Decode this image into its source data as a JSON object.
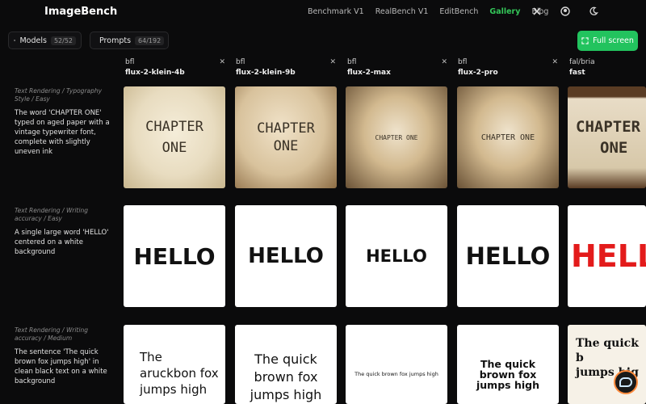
{
  "app": {
    "title": "ImageBench"
  },
  "nav": {
    "links": [
      "Benchmark V1",
      "RealBench V1",
      "EditBench",
      "Gallery",
      "Blog"
    ],
    "active": "Gallery"
  },
  "controls": {
    "models_label": "Models",
    "models_count": "52/52",
    "prompts_label": "Prompts",
    "prompts_count": "64/192",
    "fullscreen_label": "Full screen"
  },
  "columns": [
    {
      "provider": "bfl",
      "model": "flux-2-klein-4b"
    },
    {
      "provider": "bfl",
      "model": "flux-2-klein-9b"
    },
    {
      "provider": "bfl",
      "model": "flux-2-max"
    },
    {
      "provider": "bfl",
      "model": "flux-2-pro"
    },
    {
      "provider": "fal/bria",
      "model": "fast"
    }
  ],
  "rows": [
    {
      "category": "Text Rendering / Typography Style / Easy",
      "prompt": "The word 'CHAPTER ONE' typed on aged paper with a vintage typewriter font, complete with slightly uneven ink",
      "images": [
        {
          "line1": "CHAPTER",
          "line2": "ONE"
        },
        {
          "line1": "CHAPTER",
          "line2": "ONE"
        },
        {
          "line1": "CHAPTER ONE",
          "line2": ""
        },
        {
          "line1": "CHAPTER ONE",
          "line2": ""
        },
        {
          "line1": "CHAPTER",
          "line2": "ONE"
        }
      ]
    },
    {
      "category": "Text Rendering / Writing accuracy / Easy",
      "prompt": "A single large word 'HELLO' centered on a white background",
      "images": [
        {
          "line1": "HELLO",
          "line2": ""
        },
        {
          "line1": "HELLO",
          "line2": ""
        },
        {
          "line1": "HELLO",
          "line2": ""
        },
        {
          "line1": "HELLO",
          "line2": ""
        },
        {
          "line1": "HELL",
          "line2": ""
        }
      ]
    },
    {
      "category": "Text Rendering / Writing accuracy / Medium",
      "prompt": "The sentence 'The quick brown fox jumps high' in clean black text on a white background",
      "images": [
        {
          "line1": "The",
          "line2": "aruckbon fox",
          "line3": "jumps high"
        },
        {
          "line1": "The quick",
          "line2": "brown fox",
          "line3": "jumps high"
        },
        {
          "line1": "The quick brown fox jumps high",
          "line2": "",
          "line3": ""
        },
        {
          "line1": "The quick",
          "line2": "brown fox",
          "line3": "jumps high"
        },
        {
          "line1": "The quick b",
          "line2": "jumps hig",
          "line3": ""
        }
      ]
    }
  ],
  "accent_color": "#22c35e",
  "nav_active_color": "#34c759"
}
